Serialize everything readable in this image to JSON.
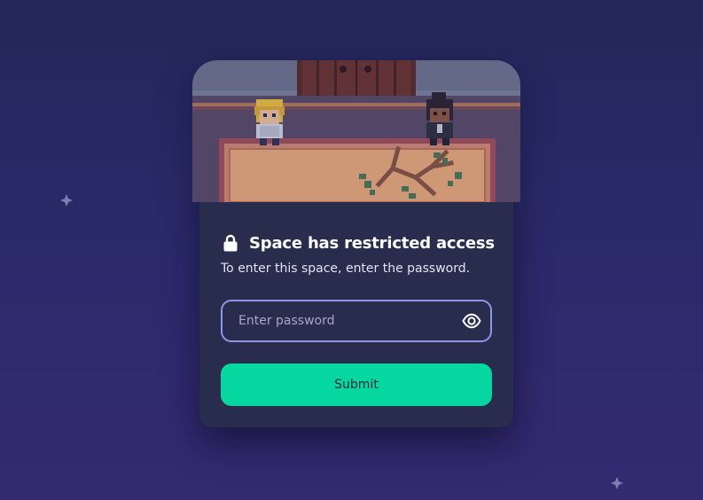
{
  "dialog": {
    "title": "Space has restricted access",
    "subtitle": "To enter this space, enter the password.",
    "password": {
      "placeholder": "Enter password",
      "value": "",
      "toggle_icon": "eye-icon"
    },
    "submit_label": "Submit",
    "lock_icon": "lock-icon"
  },
  "decorations": {
    "sparkle_icon": "sparkle-icon"
  },
  "colors": {
    "accent": "#06d6a0",
    "card_background": "#282c4d",
    "input_border": "#8f95e8",
    "page_background_top": "#232659",
    "page_background_bottom": "#342a72"
  }
}
